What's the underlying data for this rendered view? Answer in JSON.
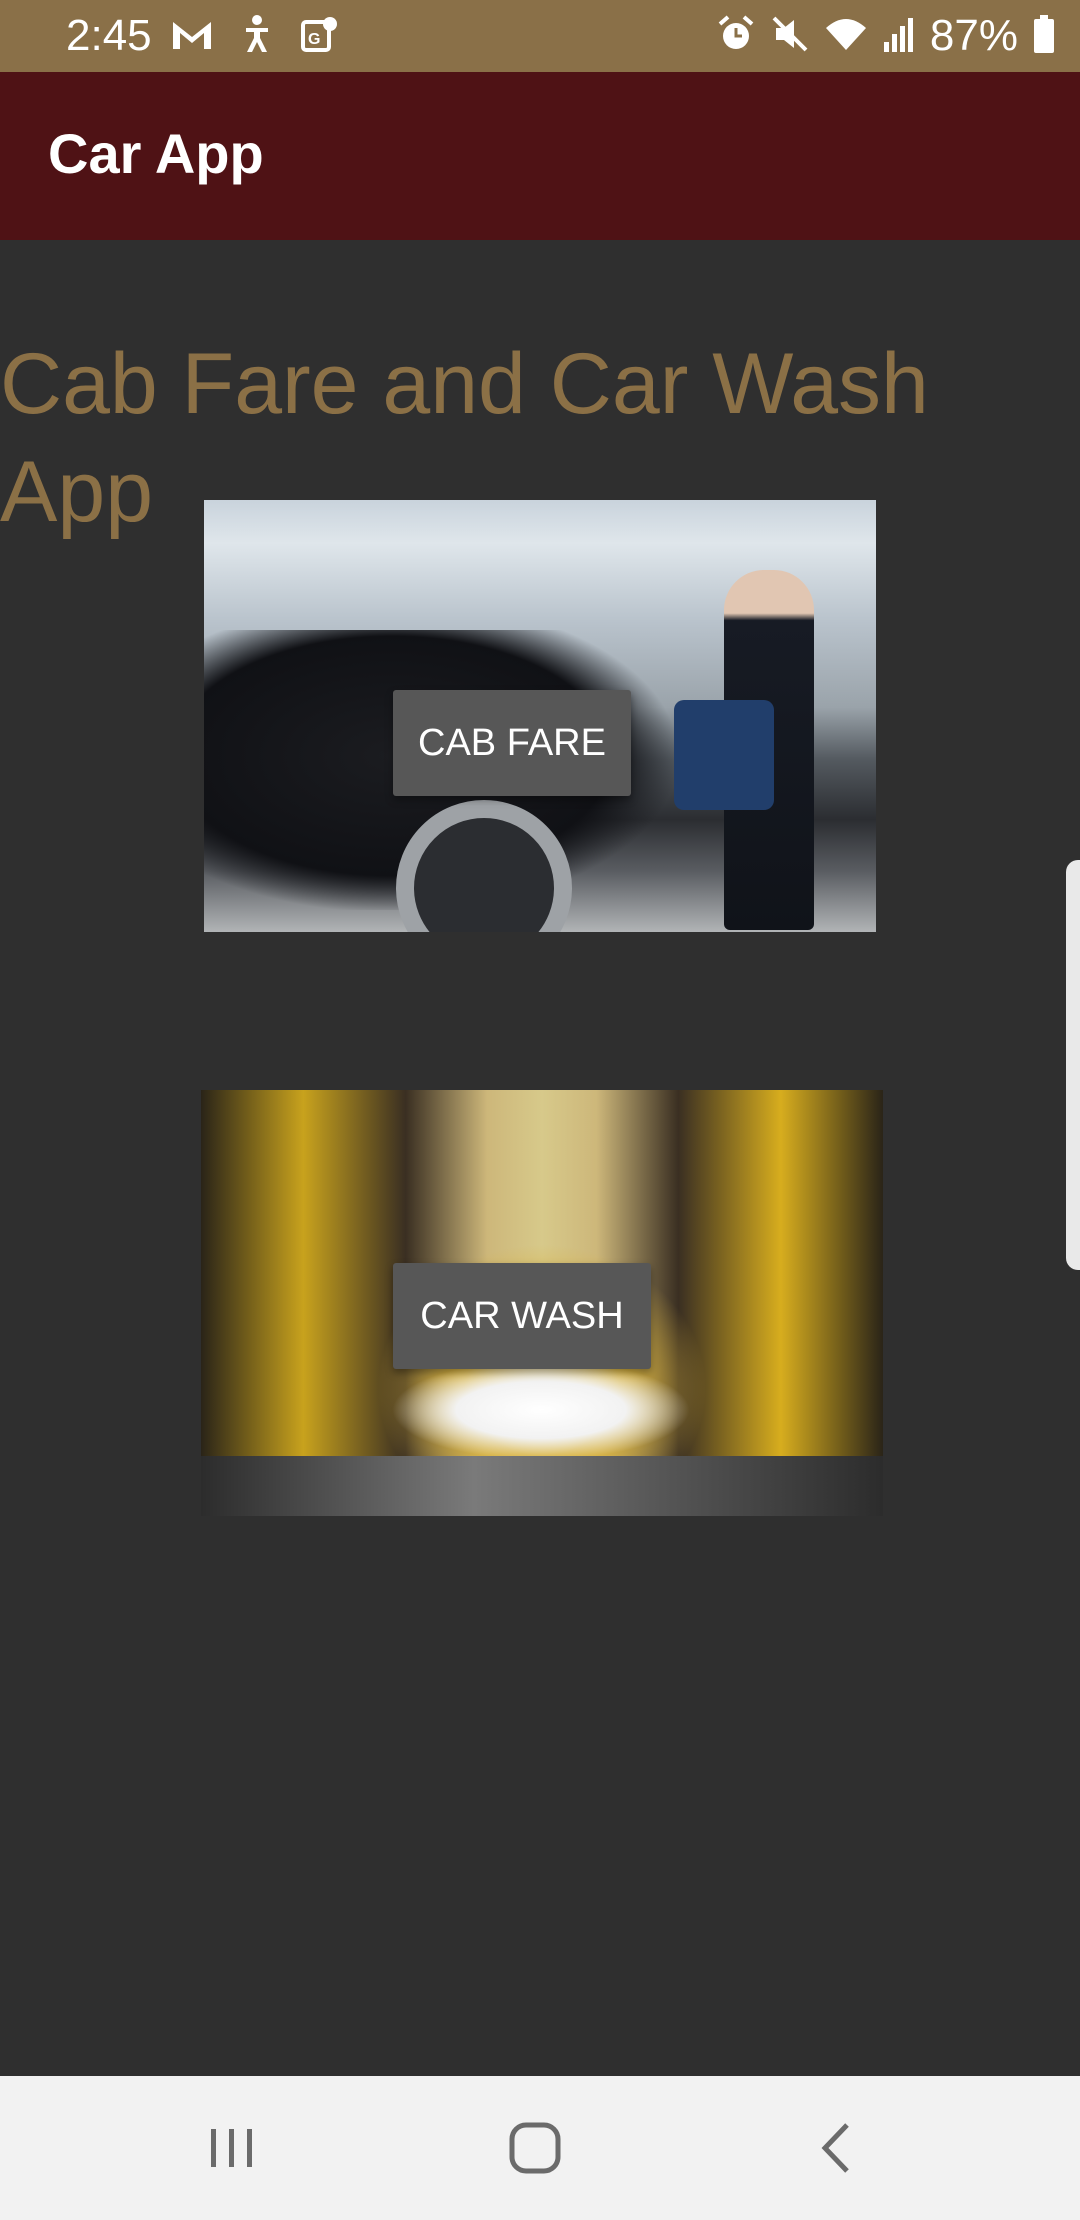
{
  "status_bar": {
    "time": "2:45",
    "battery_percent": "87%",
    "icons_left": [
      "gmail-icon",
      "accessibility-icon",
      "maps-icon"
    ],
    "icons_right": [
      "alarm-icon",
      "mute-icon",
      "wifi-icon",
      "signal-icon",
      "battery-icon"
    ]
  },
  "app_bar": {
    "title": "Car App"
  },
  "main": {
    "heading": "Cab Fare and Car Wash App",
    "cards": [
      {
        "button_label": "CAB FARE",
        "image": "cab-photo"
      },
      {
        "button_label": "CAR WASH",
        "image": "car-wash-photo"
      }
    ]
  },
  "nav_bar": {
    "buttons": [
      "recents",
      "home",
      "back"
    ]
  },
  "colors": {
    "status_bar_bg": "#8a7048",
    "app_bar_bg": "#4f1215",
    "page_bg": "#2f2f2f",
    "heading_color": "#8b7046",
    "button_bg": "#575757",
    "nav_bar_bg": "#f2f2f2"
  }
}
